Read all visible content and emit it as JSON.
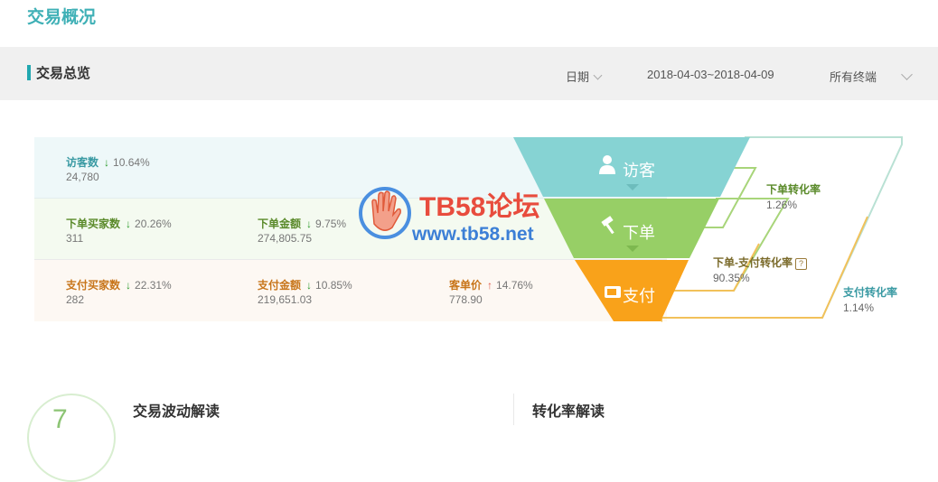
{
  "page_title": "交易概况",
  "toolbar": {
    "section_title": "交易总览",
    "date_label": "日期",
    "date_range": "2018-04-03~2018-04-09",
    "terminal_label": "所有终端"
  },
  "metrics": {
    "visitor": {
      "label": "访客数",
      "change": "10.64%",
      "value": "24,780",
      "trend": "down"
    },
    "order_buyers": {
      "label": "下单买家数",
      "change": "20.26%",
      "value": "311",
      "trend": "down"
    },
    "order_amount": {
      "label": "下单金额",
      "change": "9.75%",
      "value": "274,805.75",
      "trend": "down"
    },
    "pay_buyers": {
      "label": "支付买家数",
      "change": "22.31%",
      "value": "282",
      "trend": "down"
    },
    "pay_amount": {
      "label": "支付金额",
      "change": "10.85%",
      "value": "219,651.03",
      "trend": "down"
    },
    "unit_price": {
      "label": "客单价",
      "change": "14.76%",
      "value": "778.90",
      "trend": "up"
    }
  },
  "funnel": {
    "visitor": "访客",
    "order": "下单",
    "pay": "支付",
    "colors": {
      "visitor": "#86d3d3",
      "order": "#97cf66",
      "pay": "#f9a21a"
    }
  },
  "rates": {
    "order_rate": {
      "label": "下单转化率",
      "value": "1.26%"
    },
    "order_pay_rate": {
      "label": "下单-支付转化率",
      "value": "90.35%"
    },
    "pay_rate": {
      "label": "支付转化率",
      "value": "1.14%"
    }
  },
  "watermark": {
    "title": "TB58论坛",
    "url": "www.tb58.net"
  },
  "bottom": {
    "fluctuation_title": "交易波动解读",
    "conversion_title": "转化率解读",
    "score": "7"
  }
}
